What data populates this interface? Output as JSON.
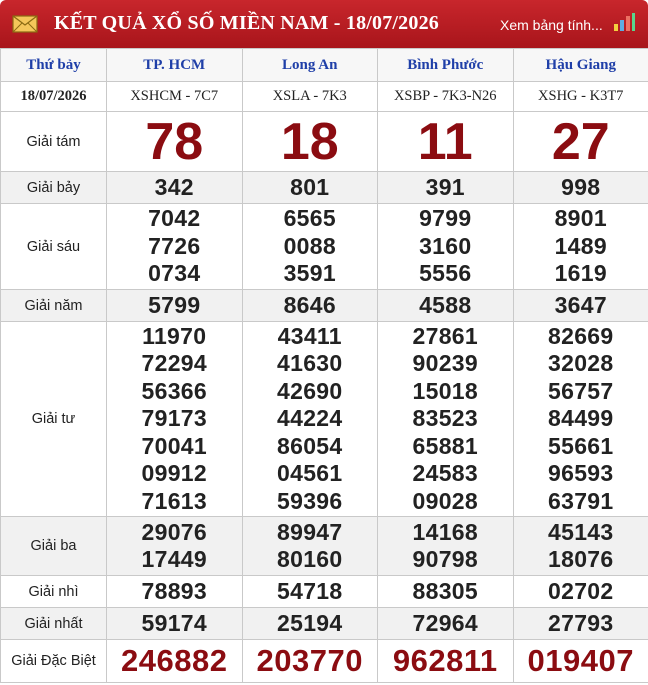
{
  "header": {
    "title": "KẾT QUẢ XỔ SỐ MIỀN NAM - 18/07/2026",
    "view_link": "Xem bảng tính...",
    "colors": {
      "header_bg": "#b41b21",
      "prize_red": "#8b0c11",
      "province_blue": "#1f3fa8"
    }
  },
  "table": {
    "day_label": "Thứ bảy",
    "date": "18/07/2026",
    "provinces": [
      {
        "name": "TP. HCM",
        "code": "XSHCM - 7C7"
      },
      {
        "name": "Long An",
        "code": "XSLA - 7K3"
      },
      {
        "name": "Bình Phước",
        "code": "XSBP - 7K3-N26"
      },
      {
        "name": "Hậu Giang",
        "code": "XSHG - K3T7"
      }
    ],
    "prizes": [
      {
        "label": "Giải tám",
        "values": [
          [
            "78"
          ],
          [
            "18"
          ],
          [
            "11"
          ],
          [
            "27"
          ]
        ]
      },
      {
        "label": "Giải bảy",
        "values": [
          [
            "342"
          ],
          [
            "801"
          ],
          [
            "391"
          ],
          [
            "998"
          ]
        ]
      },
      {
        "label": "Giải sáu",
        "values": [
          [
            "7042",
            "7726",
            "0734"
          ],
          [
            "6565",
            "0088",
            "3591"
          ],
          [
            "9799",
            "3160",
            "5556"
          ],
          [
            "8901",
            "1489",
            "1619"
          ]
        ]
      },
      {
        "label": "Giải năm",
        "values": [
          [
            "5799"
          ],
          [
            "8646"
          ],
          [
            "4588"
          ],
          [
            "3647"
          ]
        ]
      },
      {
        "label": "Giải tư",
        "values": [
          [
            "11970",
            "72294",
            "56366",
            "79173",
            "70041",
            "09912",
            "71613"
          ],
          [
            "43411",
            "41630",
            "42690",
            "44224",
            "86054",
            "04561",
            "59396"
          ],
          [
            "27861",
            "90239",
            "15018",
            "83523",
            "65881",
            "24583",
            "09028"
          ],
          [
            "82669",
            "32028",
            "56757",
            "84499",
            "55661",
            "96593",
            "63791"
          ]
        ]
      },
      {
        "label": "Giải ba",
        "values": [
          [
            "29076",
            "17449"
          ],
          [
            "89947",
            "80160"
          ],
          [
            "14168",
            "90798"
          ],
          [
            "45143",
            "18076"
          ]
        ]
      },
      {
        "label": "Giải nhì",
        "values": [
          [
            "78893"
          ],
          [
            "54718"
          ],
          [
            "88305"
          ],
          [
            "02702"
          ]
        ]
      },
      {
        "label": "Giải nhất",
        "values": [
          [
            "59174"
          ],
          [
            "25194"
          ],
          [
            "72964"
          ],
          [
            "27793"
          ]
        ]
      },
      {
        "label": "Giải Đặc Biệt",
        "values": [
          [
            "246882"
          ],
          [
            "203770"
          ],
          [
            "962811"
          ],
          [
            "019407"
          ]
        ]
      }
    ]
  }
}
